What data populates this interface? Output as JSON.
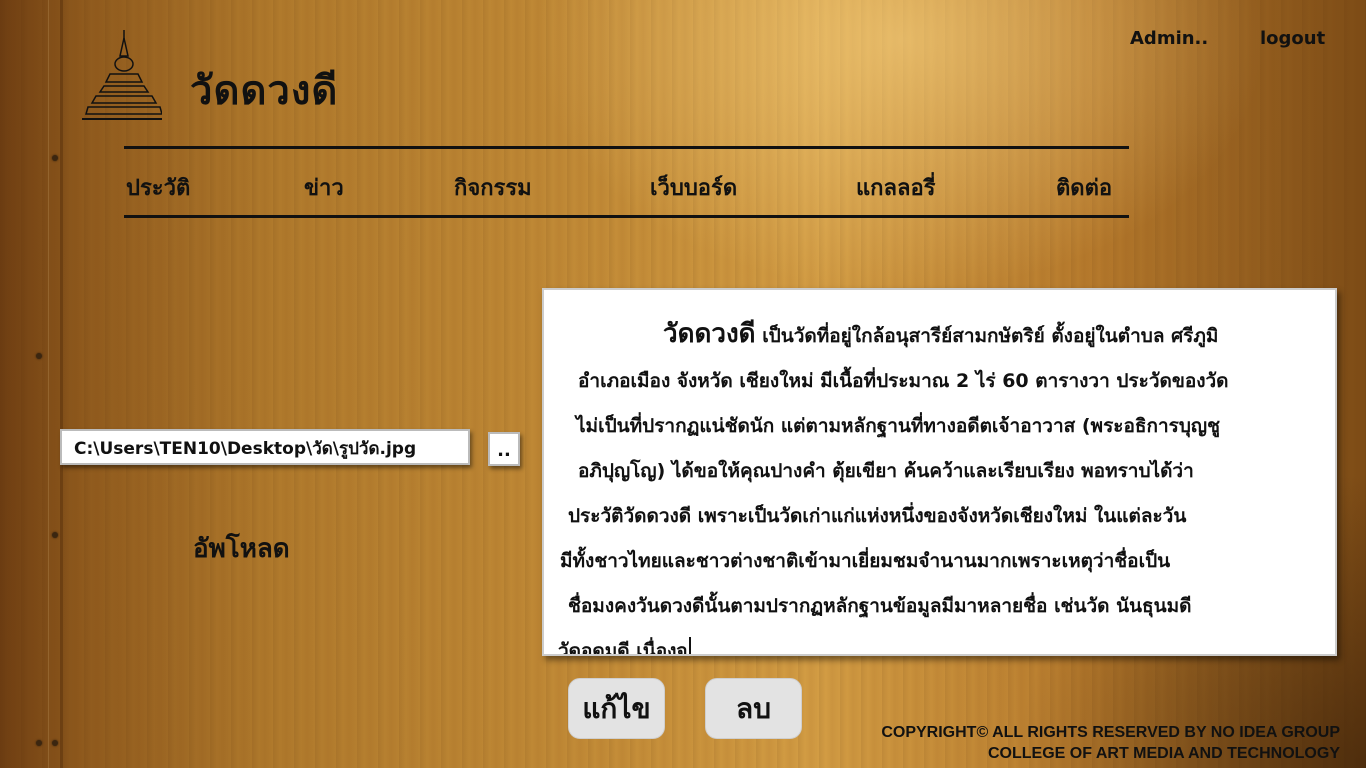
{
  "header": {
    "site_title": "วัดดวงดี",
    "admin_link": "Admin..",
    "logout_link": "logout"
  },
  "nav": {
    "items": [
      {
        "label": "ประวัติ"
      },
      {
        "label": "ข่าว"
      },
      {
        "label": "กิจกรรม"
      },
      {
        "label": "เว็บบอร์ด"
      },
      {
        "label": "แกลลอรี่"
      },
      {
        "label": "ติดต่อ"
      }
    ]
  },
  "upload": {
    "file_path": "C:\\Users\\TEN10\\Desktop\\วัด\\รูปวัด.jpg",
    "browse_label": "..",
    "upload_label": "อัพโหลด"
  },
  "editor": {
    "heading": "วัดดวงดี",
    "first_line_rest": "เป็นวัดที่อยู่ใกล้อนุสารีย์สามกษัตริย์ ตั้งอยู่ในตำบล ศรีภูมิ",
    "lines": [
      "อำเภอเมือง จังหวัด เชียงใหม่ มีเนื้อที่ประมาณ 2 ไร่ 60 ตารางวา ประวัดของวัด",
      "ไม่เป็นที่ปรากฏแน่ชัดนัก แต่ตามหลักฐานที่ทางอดีตเจ้าอาวาส (พระอธิการบุญชู",
      "อภิปุญโญ) ได้ขอให้คุณปางคำ ตุ้ยเขียา ค้นคว้าและเรียบเรียง พอทราบได้ว่า",
      "ประวัติวัดดวงดี เพราะเป็นวัดเก่าแก่แห่งหนึ่งของจังหวัดเชียงใหม่ ในแต่ละวัน",
      "มีทั้งชาวไทยและชาวต่างชาติเข้ามาเยี่ยมชมจำนานมากเพราะเหตุว่าชื่อเป็น",
      "ชื่อมงคงวันดวงดีนั้นตามปรากฏหลักฐานข้อมูลมีมาหลายชื่อ เช่นวัด นันธุนมดี",
      "วัดอุดมดี เนื่องจ"
    ]
  },
  "actions": {
    "edit_label": "แก้ไข",
    "delete_label": "ลบ"
  },
  "footer": {
    "line1": "COPYRIGHT©  ALL RIGHTS RESERVED BY NO IDEA GROUP",
    "line2": "COLLEGE OF ART MEDIA AND TECHNOLOGY"
  },
  "colors": {
    "wood_light": "#d39d44",
    "wood_dark": "#6e3e12",
    "text": "#111111",
    "button_bg": "#e3e3e3"
  }
}
